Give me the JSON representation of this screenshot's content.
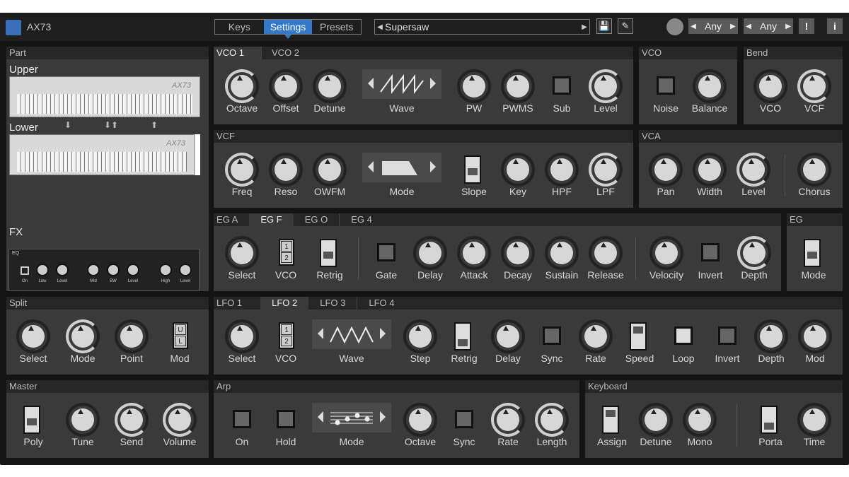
{
  "app": {
    "title": "AX73"
  },
  "tabs": [
    "Keys",
    "Settings",
    "Presets"
  ],
  "preset": {
    "name": "Supersaw"
  },
  "selectors": [
    {
      "value": "Any"
    },
    {
      "value": "Any"
    }
  ],
  "buttons": {
    "warn": "!",
    "info": "i"
  },
  "part": {
    "header": "Part",
    "upper": "Upper",
    "lower": "Lower",
    "fx": "FX",
    "fx_eq": "EQ",
    "brand": "AX73",
    "fx_labels": [
      "On",
      "Low",
      "Level",
      "Mid",
      "BW",
      "Level",
      "High",
      "Level"
    ]
  },
  "vco": {
    "tabs": [
      "VCO 1",
      "VCO 2"
    ],
    "controls": [
      "Octave",
      "Offset",
      "Detune",
      "Wave",
      "PW",
      "PWMS",
      "Sub",
      "Level"
    ]
  },
  "vco_mix": {
    "header": "VCO",
    "controls": [
      "Noise",
      "Balance"
    ]
  },
  "bend": {
    "header": "Bend",
    "controls": [
      "VCO",
      "VCF"
    ]
  },
  "vcf": {
    "header": "VCF",
    "controls": [
      "Freq",
      "Reso",
      "OWFM",
      "Mode",
      "Slope",
      "Key",
      "HPF",
      "LPF"
    ]
  },
  "vca": {
    "header": "VCA",
    "controls": [
      "Pan",
      "Width",
      "Level",
      "Chorus"
    ]
  },
  "eg": {
    "tabs": [
      "EG A",
      "EG F",
      "EG O",
      "EG 4"
    ],
    "controls": [
      "Select",
      "VCO",
      "Retrig",
      "Gate",
      "Delay",
      "Attack",
      "Decay",
      "Sustain",
      "Release",
      "Velocity",
      "Invert",
      "Depth"
    ]
  },
  "eg_mode": {
    "header": "EG",
    "controls": [
      "Mode"
    ]
  },
  "split": {
    "header": "Split",
    "controls": [
      "Select",
      "Mode",
      "Point",
      "Mod"
    ]
  },
  "lfo": {
    "tabs": [
      "LFO 1",
      "LFO 2",
      "LFO 3",
      "LFO 4"
    ],
    "controls": [
      "Select",
      "VCO",
      "Wave",
      "Step",
      "Retrig",
      "Delay",
      "Sync",
      "Rate",
      "Speed",
      "Loop",
      "Invert",
      "Depth",
      "Mod"
    ]
  },
  "master": {
    "header": "Master",
    "controls": [
      "Poly",
      "Tune",
      "Send",
      "Volume"
    ]
  },
  "arp": {
    "header": "Arp",
    "controls": [
      "On",
      "Hold",
      "Mode",
      "Octave",
      "Sync",
      "Rate",
      "Length"
    ]
  },
  "keyboard": {
    "header": "Keyboard",
    "controls": [
      "Assign",
      "Detune",
      "Mono",
      "Porta",
      "Time"
    ]
  },
  "colors": {
    "accent": "#3478c8",
    "panel": "#3a3a3a",
    "header": "#262626",
    "bg": "#141414"
  }
}
